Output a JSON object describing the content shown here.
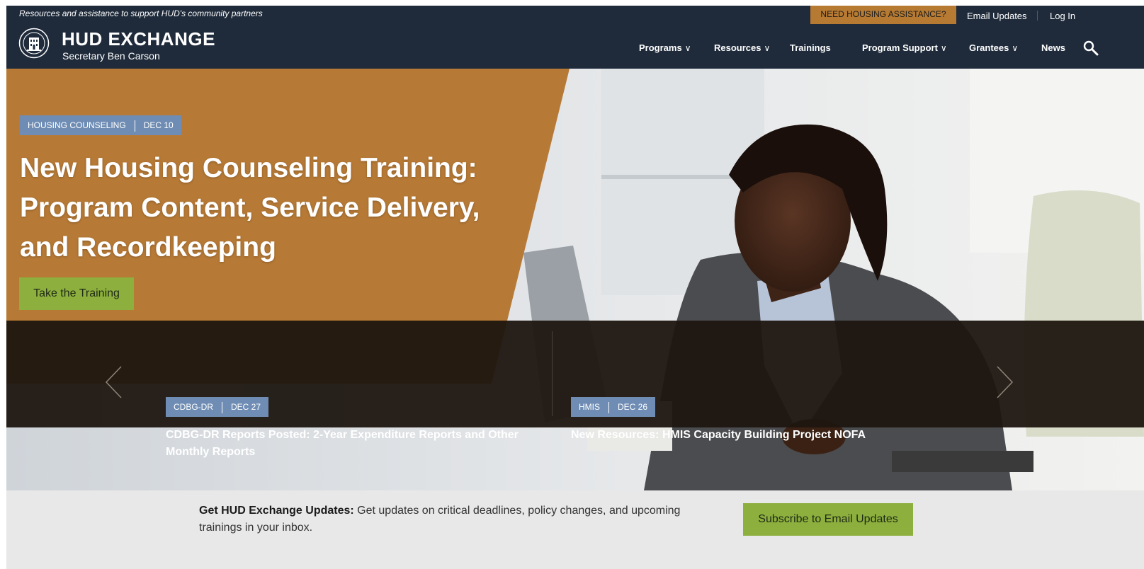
{
  "header": {
    "tagline": "Resources and assistance to support HUD's community partners",
    "need_assistance": "NEED HOUSING ASSISTANCE?",
    "email_updates": "Email Updates",
    "log_in": "Log In",
    "logo_title": "HUD EXCHANGE",
    "logo_subtitle": "Secretary Ben Carson",
    "nav": [
      {
        "label": "Programs",
        "dropdown": true
      },
      {
        "label": "Resources",
        "dropdown": true
      },
      {
        "label": "Trainings",
        "dropdown": false
      },
      {
        "label": "Program Support",
        "dropdown": true
      },
      {
        "label": "Grantees",
        "dropdown": true
      },
      {
        "label": "News",
        "dropdown": false
      }
    ],
    "chevron": "∨",
    "search_icon": "search-icon"
  },
  "hero": {
    "tag_category": "HOUSING COUNSELING",
    "tag_date": "DEC 10",
    "title": "New Housing Counseling Training: Program Content, Service Delivery, and Recordkeeping",
    "cta_label": "Take the Training"
  },
  "news": [
    {
      "category": "CDBG-DR",
      "date": "DEC 27",
      "title": "CDBG-DR Reports Posted: 2-Year Expenditure Reports and Other Monthly Reports"
    },
    {
      "category": "HMIS",
      "date": "DEC 26",
      "title": "New Resources: HMIS Capacity Building Project NOFA"
    }
  ],
  "updates": {
    "heading": "Get HUD Exchange Updates:",
    "text": "Get updates on critical deadlines, policy changes, and upcoming trainings in your inbox.",
    "button_label": "Subscribe to Email Updates"
  },
  "colors": {
    "header_bg": "#1f2b3b",
    "accent_orange": "#b77a36",
    "tag_blue": "#6f8db4",
    "button_green": "#8daf3e"
  }
}
